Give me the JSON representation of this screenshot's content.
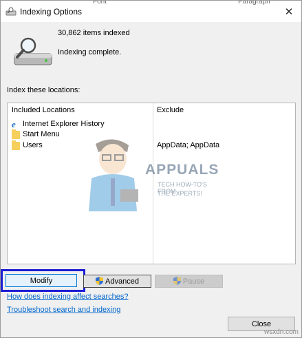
{
  "window": {
    "title": "Indexing Options",
    "close_glyph": "✕"
  },
  "behind": {
    "left": "Font",
    "right": "Paragraph"
  },
  "status": {
    "items_indexed": "30,862 items indexed",
    "state": "Indexing complete."
  },
  "locations": {
    "heading": "Index these locations:",
    "columns": [
      "Included Locations",
      "Exclude"
    ],
    "rows": [
      {
        "name": "Internet Explorer History",
        "icon": "internet-explorer-icon",
        "exclude": ""
      },
      {
        "name": "Start Menu",
        "icon": "folder-icon",
        "exclude": ""
      },
      {
        "name": "Users",
        "icon": "folder-icon",
        "exclude": "AppData; AppData"
      }
    ]
  },
  "watermark": {
    "title": "APPUALS",
    "tagline1": "TECH HOW-TO'S FROM",
    "tagline2": "THE EXPERTS!"
  },
  "buttons": {
    "modify": "Modify",
    "advanced": "Advanced",
    "pause": "Pause",
    "close": "Close"
  },
  "links": {
    "help": "How does indexing affect searches?",
    "troubleshoot": "Troubleshoot search and indexing"
  },
  "site_mark": "wsxdn.com",
  "colors": {
    "highlight": "#1d1dd6",
    "link": "#0066cc",
    "folder": "#f6cf5c"
  }
}
